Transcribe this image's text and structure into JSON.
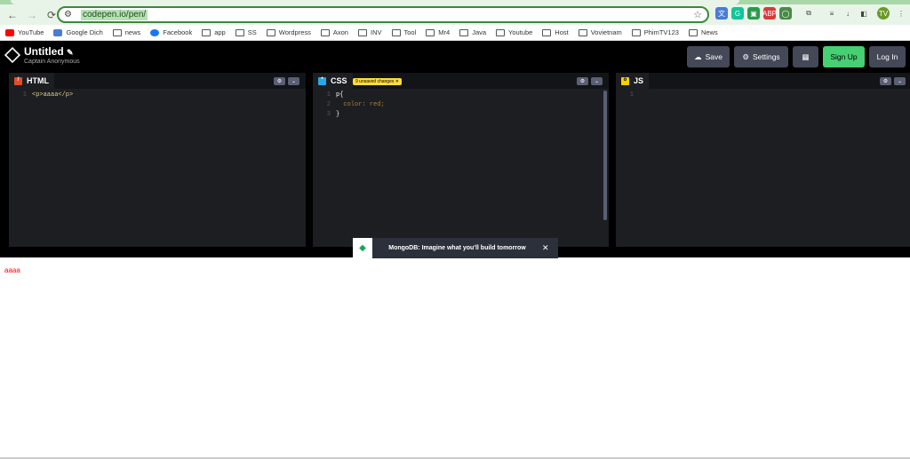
{
  "browser": {
    "url": "codepen.io/pen/",
    "nav": {
      "back": "←",
      "forward": "→",
      "reload": "⟳"
    },
    "extensions": [
      {
        "name": "translate-icon",
        "color": "#4a7bd6",
        "glyph": "文"
      },
      {
        "name": "grammarly-icon",
        "color": "#15c39a",
        "glyph": "G"
      },
      {
        "name": "extension-green-icon",
        "color": "#2a9a4a",
        "glyph": "▣"
      },
      {
        "name": "adblock-icon",
        "color": "#d63a3a",
        "glyph": "ABP"
      },
      {
        "name": "chat-icon",
        "color": "#4a8a4a",
        "glyph": "◯"
      },
      {
        "name": "puzzle-icon",
        "color": "#666",
        "glyph": "⧉"
      },
      {
        "name": "media-icon",
        "color": "#666",
        "glyph": "≡"
      },
      {
        "name": "download-icon",
        "color": "#666",
        "glyph": "↓"
      },
      {
        "name": "sidepanel-icon",
        "color": "#333",
        "glyph": "◧"
      },
      {
        "name": "profile-avatar-icon",
        "color": "#6a9a2a",
        "glyph": "TV"
      },
      {
        "name": "menu-icon",
        "color": "#666",
        "glyph": "⋮"
      }
    ],
    "bookmarks": [
      {
        "label": "YouTube",
        "icon": "youtube-icon",
        "color": "#f00"
      },
      {
        "label": "Google Dịch",
        "icon": "translate-icon",
        "color": "#4a7bd6"
      },
      {
        "label": "news",
        "icon": "folder-icon"
      },
      {
        "label": "Facebook",
        "icon": "facebook-icon",
        "color": "#1877f2"
      },
      {
        "label": "app",
        "icon": "folder-icon"
      },
      {
        "label": "SS",
        "icon": "folder-icon"
      },
      {
        "label": "Wordpress",
        "icon": "folder-icon"
      },
      {
        "label": "Axon",
        "icon": "folder-icon"
      },
      {
        "label": "INV",
        "icon": "folder-icon"
      },
      {
        "label": "Tool",
        "icon": "folder-icon"
      },
      {
        "label": "Mr4",
        "icon": "folder-icon"
      },
      {
        "label": "Java",
        "icon": "folder-icon"
      },
      {
        "label": "Youtube",
        "icon": "folder-icon"
      },
      {
        "label": "Host",
        "icon": "folder-icon"
      },
      {
        "label": "Vovietnam",
        "icon": "folder-icon"
      },
      {
        "label": "PhimTV123",
        "icon": "folder-icon"
      },
      {
        "label": "News",
        "icon": "folder-icon"
      }
    ]
  },
  "codepen": {
    "title": "Untitled",
    "edit_glyph": "✎",
    "author": "Captain Anonymous",
    "buttons": {
      "save": "Save",
      "settings": "Settings",
      "signup": "Sign Up",
      "login": "Log In"
    },
    "colors": {
      "signup": "#47cf73",
      "button": "#444857",
      "css_badge": "#ffdd40"
    },
    "panes": {
      "html": {
        "label": "HTML",
        "lines": [
          "<p>aaaa</p>"
        ]
      },
      "css": {
        "label": "CSS",
        "badge": "9 unsaved changes ✕",
        "lines": [
          "p{",
          "  color: red;",
          "}"
        ]
      },
      "js": {
        "label": "JS",
        "lines": [
          ""
        ]
      }
    },
    "ad": {
      "text": "MongoDB: Imagine what you'll build tomorrow",
      "close": "✕"
    },
    "preview_text": "aaaa"
  }
}
